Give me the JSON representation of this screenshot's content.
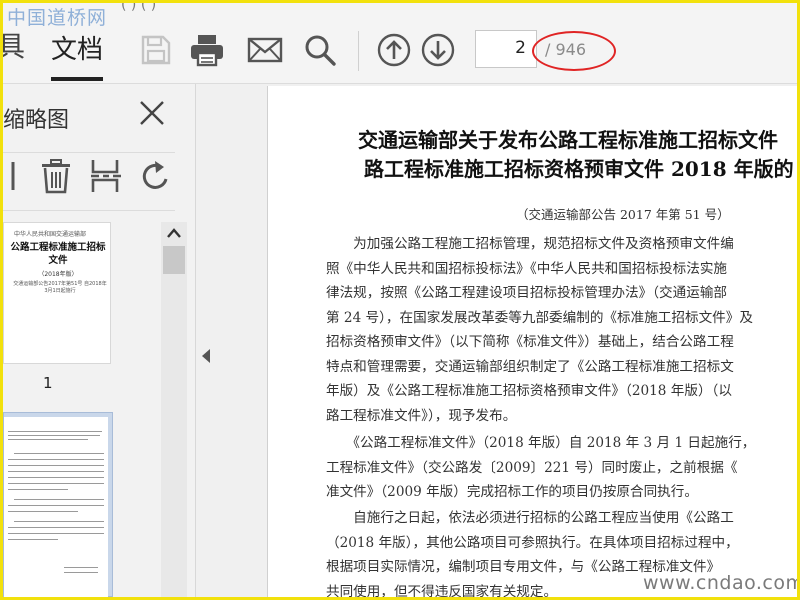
{
  "watermark_top": "中国道桥网",
  "watermark_bottom": "www.cndao.com",
  "top_partial_text": "(  ) (  )",
  "tabs": {
    "partial_left": "具",
    "active": "文档"
  },
  "toolbar_icons": [
    "save-icon",
    "print-icon",
    "email-icon",
    "search-icon",
    "prev-page-icon",
    "next-page-icon"
  ],
  "page_nav": {
    "current": "2",
    "total": "/ 946"
  },
  "sidebar": {
    "title": "缩略图",
    "tools": [
      "delete-icon",
      "extract-icon",
      "rotate-icon"
    ],
    "thumb1": {
      "org": "中华人民共和国交通运输部",
      "title": "公路工程标准施工招标文件",
      "year": "（2018年版）",
      "foot": "交通运输部公告2017年第51号 自2018年3月1日起施行",
      "number": "1"
    }
  },
  "document": {
    "title_line1": "交通运输部关于发布公路工程标准施工招标文件",
    "title_line2": "路工程标准施工招标资格预审文件 2018 年版的",
    "subtitle": "（交通运输部公告 2017 年第 51 号）",
    "paragraphs": [
      [
        "　　为加强公路工程施工招标管理，规范招标文件及资格预审文件编",
        "照《中华人民共和国招标投标法》《中华人民共和国招标投标法实施",
        "律法规，按照《公路工程建设项目招标投标管理办法》（交通运输部",
        "第 24 号），在国家发展改革委等九部委编制的《标准施工招标文件》及",
        "招标资格预审文件》（以下简称《标准文件》）基础上，结合公路工程",
        "特点和管理需要，交通运输部组织制定了《公路工程标准施工招标文",
        "年版）及《公路工程标准施工招标资格预审文件》（2018 年版）（以",
        "路工程标准文件》），现予发布。"
      ],
      [
        "　　《公路工程标准文件》（2018 年版）自 2018 年 3 月 1 日起施行，",
        "工程标准文件》（交公路发〔2009〕221 号）同时废止，之前根据《",
        "准文件》（2009 年版）完成招标工作的项目仍按原合同执行。"
      ],
      [
        "　　自施行之日起，依法必须进行招标的公路工程应当使用《公路工",
        "（2018 年版），其他公路项目可参照执行。在具体项目招标过程中，",
        "根据项目实际情况，编制项目专用文件，与《公路工程标准文件》",
        "共同使用，但不得违反国家有关规定。"
      ]
    ]
  },
  "colors": {
    "frame": "#f2e10c",
    "highlight_ellipse": "#e02424",
    "icon_gray": "#555555"
  }
}
